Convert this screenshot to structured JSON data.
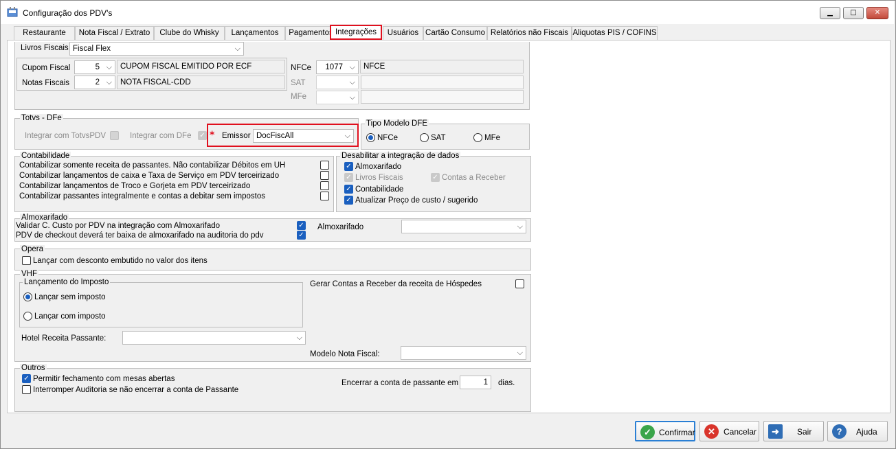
{
  "window": {
    "title": "Configuração dos PDV's",
    "min": "▁",
    "max": "□",
    "close": "✕"
  },
  "tabs": [
    "Restaurante",
    "Nota Fiscal / Extrato",
    "Clube do Whisky",
    "Lançamentos",
    "Pagamentos",
    "Integrações",
    "Usuários",
    "Cartão Consumo",
    "Relatórios não Fiscais",
    "Aliquotas PIS / COFINS"
  ],
  "livros": {
    "label": "Livros Fiscais",
    "value": "Fiscal Flex"
  },
  "cupom": {
    "label": "Cupom Fiscal",
    "num": "5",
    "desc": "CUPOM FISCAL EMITIDO POR ECF"
  },
  "notas": {
    "label": "Notas Fiscais",
    "num": "2",
    "desc": "NOTA FISCAL-CDD"
  },
  "nfce": {
    "label": "NFCe",
    "num": "1077",
    "desc": "NFCE"
  },
  "sat": {
    "label": "SAT"
  },
  "mfe": {
    "label": "MFe"
  },
  "totvs": {
    "title": "Totvs - DFe",
    "integrar_totvs": "Integrar com TotvsPDV",
    "integrar_dfe": "Integrar com  DFe",
    "required": "*",
    "emissor_label": "Emissor",
    "emissor_value": "DocFiscAll"
  },
  "tipo": {
    "title": "Tipo Modelo DFE",
    "options": [
      "NFCe",
      "SAT",
      "MFe"
    ]
  },
  "contab": {
    "title": "Contabilidade",
    "items": [
      "Contabilizar somente receita de passantes. Não contabilizar Débitos em UH",
      "Contabilizar lançamentos de caixa e Taxa de Serviço em PDV terceirizado",
      "Contabilizar lançamentos de Troco e Gorjeta em PDV terceirizado",
      "Contabilizar passantes integralmente e contas a debitar sem impostos"
    ]
  },
  "desab": {
    "title": "Desabilitar a integração de dados",
    "almox": "Almoxarifado",
    "livros": "Livros Fiscais",
    "contas": "Contas a Receber",
    "contab": "Contabilidade",
    "atualizar": "Atualizar Preço de custo / sugerido"
  },
  "almox": {
    "title": "Almoxarifado",
    "item1": "Validar C. Custo por PDV na integração com Almoxarifado",
    "item2": "PDV de checkout deverá ter baixa de almoxarifado na auditoria do pdv",
    "label": "Almoxarifado"
  },
  "opera": {
    "title": "Opera",
    "item": "Lançar com desconto embutido no valor dos itens"
  },
  "vhf": {
    "title": "VHF",
    "lanc_title": "Lançamento do Imposto",
    "sem": "Lançar sem imposto",
    "com": "Lançar com imposto",
    "hotel_label": "Hotel Receita Passante:",
    "gerar": "Gerar Contas a Receber da receita de Hóspedes",
    "modelo_label": "Modelo Nota Fiscal:"
  },
  "outros": {
    "title": "Outros",
    "permitir": "Permitir fechamento com mesas abertas",
    "interromper": "Interromper Auditoria se não encerrar a conta de Passante",
    "encerrar": "Encerrar a conta de passante em",
    "dias_value": "1",
    "dias": "dias."
  },
  "buttons": {
    "confirmar": "Confirmar",
    "cancelar": "Cancelar",
    "sair": "Sair",
    "ajuda": "Ajuda"
  }
}
